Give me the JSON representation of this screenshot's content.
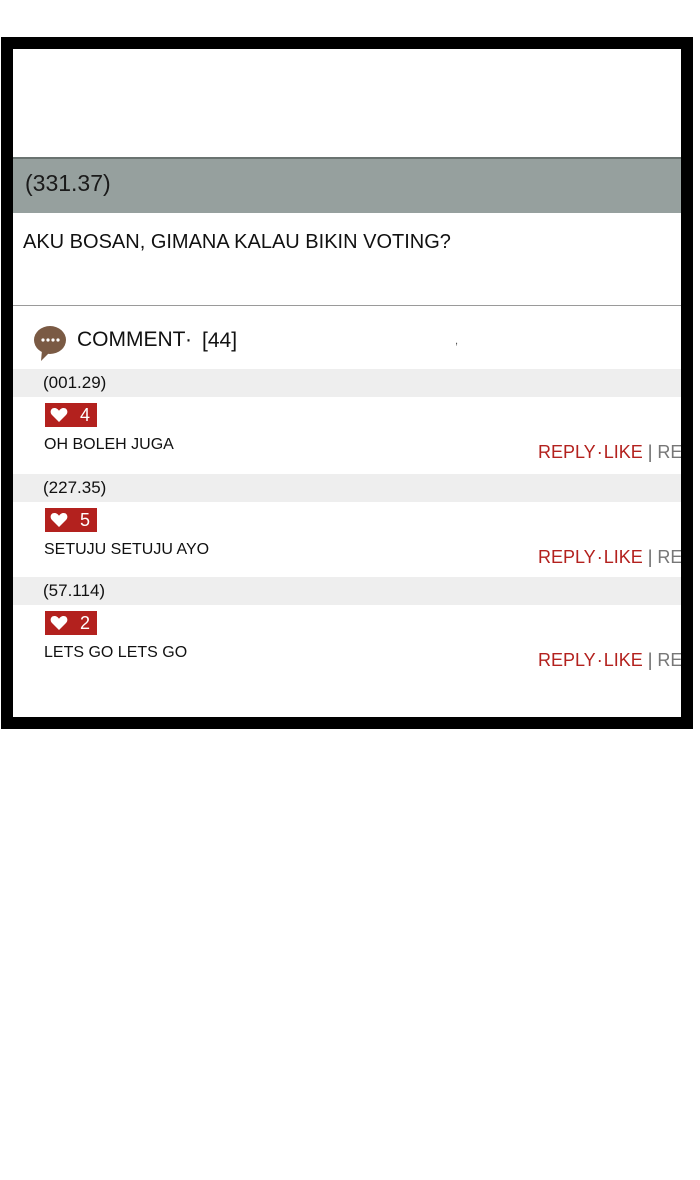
{
  "post": {
    "id": "(331.37)",
    "text": "AKU BOSAN, GIMANA KALAU BIKIN VOTING?"
  },
  "comments_section": {
    "title": "COMMENT",
    "dot": "·",
    "count": "[44]",
    "tick": ","
  },
  "comments": [
    {
      "user": "(001.29)",
      "likes": "4",
      "text": "OH BOLEH JUGA",
      "reply_label": "REPLY",
      "like_label": "LIKE",
      "trail": "REP"
    },
    {
      "user": "(227.35)",
      "likes": "5",
      "text": "SETUJU SETUJU AYO",
      "reply_label": "REPLY",
      "like_label": "LIKE",
      "trail": "REP"
    },
    {
      "user": "(57.114)",
      "likes": "2",
      "text": "LETS GO LETS GO",
      "reply_label": "REPLY",
      "like_label": "LIKE",
      "trail": "REP"
    }
  ],
  "colors": {
    "header_bar": "#96a09e",
    "like_badge": "#b3211e",
    "action_text": "#b3211e",
    "comment_icon": "#7a5a44"
  },
  "icons": {
    "comment": "speech-bubble-icon",
    "heart": "heart-icon"
  }
}
